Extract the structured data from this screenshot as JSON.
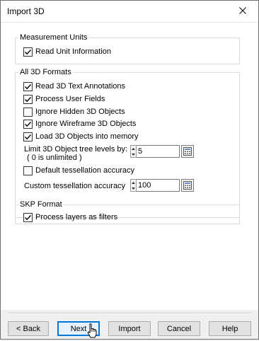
{
  "window": {
    "title": "Import 3D"
  },
  "measurement_units": {
    "legend": "Measurement Units",
    "read_unit_information": {
      "label": "Read Unit Information",
      "checked": true
    }
  },
  "all_3d_formats": {
    "legend": "All 3D Formats",
    "options": [
      {
        "label": "Read 3D Text Annotations",
        "checked": true
      },
      {
        "label": "Process User Fields",
        "checked": true
      },
      {
        "label": "Ignore Hidden 3D Objects",
        "checked": false
      },
      {
        "label": "Ignore Wireframe 3D Objects",
        "checked": true
      },
      {
        "label": "Load 3D Objects into memory",
        "checked": true
      }
    ],
    "tree_levels": {
      "label_line1": "Limit 3D Object tree levels by:",
      "label_line2": "( 0 is unlimited )",
      "value": "5"
    },
    "default_tessellation": {
      "label": "Default tessellation accuracy",
      "checked": false
    },
    "custom_tessellation": {
      "label": "Custom tessellation accuracy",
      "value": "100"
    }
  },
  "skp_format": {
    "legend": "SKP Format",
    "process_layers": {
      "label": "Process layers as filters",
      "checked": true
    }
  },
  "buttons": {
    "back": "< Back",
    "next": "Next",
    "import": "Import",
    "cancel": "Cancel",
    "help": "Help"
  },
  "icons": {
    "close": "close-icon",
    "checkmark": "checkmark-icon",
    "spin_up": "spin-up-icon",
    "spin_down": "spin-down-icon",
    "calculator": "calculator-icon",
    "cursor": "mouse-pointer-icon"
  }
}
